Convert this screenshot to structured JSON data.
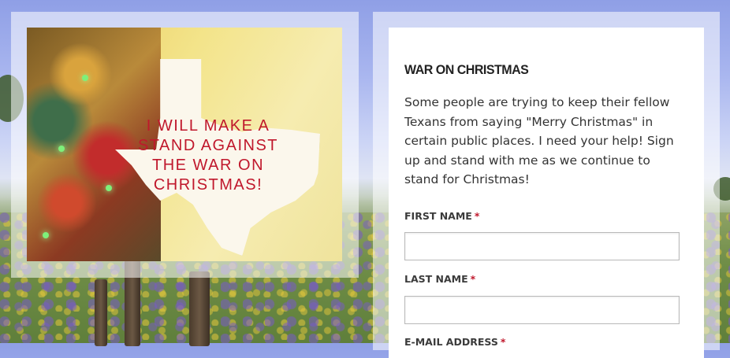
{
  "promo": {
    "headline": "I WILL MAKE A STAND AGAINST THE WAR ON CHRISTMAS!"
  },
  "form": {
    "title": "WAR ON CHRISTMAS",
    "description": "Some people are trying to keep their fellow Texans from saying \"Merry Christmas\" in certain public places. I need your help! Sign up and stand with me as we continue to stand for Christmas!",
    "required_marker": "*",
    "fields": [
      {
        "label": "FIRST NAME",
        "value": ""
      },
      {
        "label": "LAST NAME",
        "value": ""
      },
      {
        "label": "E-MAIL ADDRESS",
        "value": ""
      }
    ]
  },
  "colors": {
    "accent": "#c0182c",
    "card": "#ffffff"
  }
}
